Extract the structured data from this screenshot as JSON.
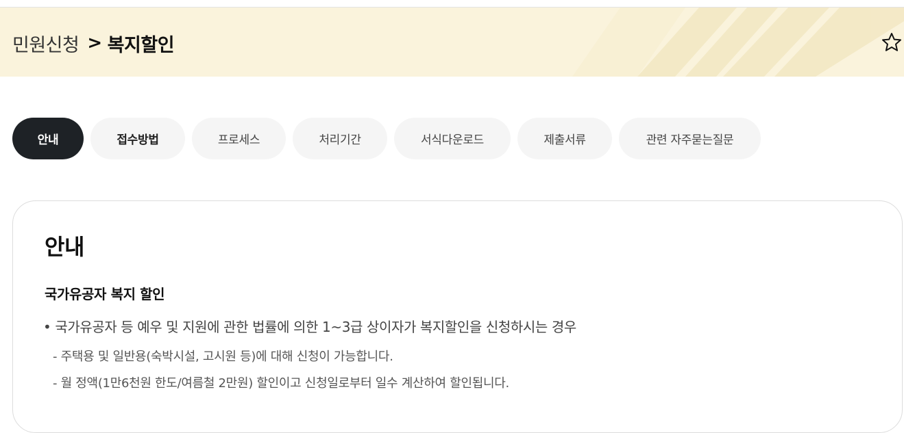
{
  "breadcrumb": {
    "parent": "민원신청",
    "separator": ">",
    "current": "복지할인"
  },
  "favorite": {
    "icon": "star-outline-icon"
  },
  "tabs": [
    {
      "label": "안내",
      "active": true
    },
    {
      "label": "접수방법",
      "active": false
    },
    {
      "label": "프로세스",
      "active": false
    },
    {
      "label": "처리기간",
      "active": false
    },
    {
      "label": "서식다운로드",
      "active": false
    },
    {
      "label": "제출서류",
      "active": false
    },
    {
      "label": "관련 자주묻는질문",
      "active": false
    }
  ],
  "section": {
    "title": "안내",
    "subtitle": "국가유공자 복지 할인",
    "bullet": "• 국가유공자 등 예우 및 지원에 관한 법률에 의한 1~3급 상이자가 복지할인을 신청하시는 경우",
    "details": [
      "- 주택용 및 일반용(숙박시설, 고시원 등)에 대해 신청이 가능합니다.",
      "- 월 정액(1만6천원 한도/여름철 2만원) 할인이고 신청일로부터 일수 계산하여 할인됩니다."
    ]
  },
  "colors": {
    "header_band": "#faf3dc",
    "active_tab": "#1e2226",
    "inactive_tab": "#f5f5f5"
  }
}
